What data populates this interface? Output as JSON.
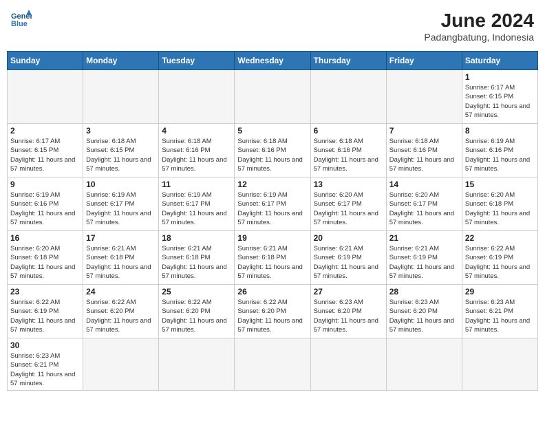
{
  "header": {
    "logo_general": "General",
    "logo_blue": "Blue",
    "month_year": "June 2024",
    "location": "Padangbatung, Indonesia"
  },
  "days_of_week": [
    "Sunday",
    "Monday",
    "Tuesday",
    "Wednesday",
    "Thursday",
    "Friday",
    "Saturday"
  ],
  "weeks": [
    [
      {
        "day": "",
        "empty": true
      },
      {
        "day": "",
        "empty": true
      },
      {
        "day": "",
        "empty": true
      },
      {
        "day": "",
        "empty": true
      },
      {
        "day": "",
        "empty": true
      },
      {
        "day": "",
        "empty": true
      },
      {
        "day": "1",
        "sunrise": "6:17 AM",
        "sunset": "6:15 PM",
        "daylight": "11 hours and 57 minutes."
      }
    ],
    [
      {
        "day": "2",
        "sunrise": "6:17 AM",
        "sunset": "6:15 PM",
        "daylight": "11 hours and 57 minutes."
      },
      {
        "day": "3",
        "sunrise": "6:18 AM",
        "sunset": "6:15 PM",
        "daylight": "11 hours and 57 minutes."
      },
      {
        "day": "4",
        "sunrise": "6:18 AM",
        "sunset": "6:16 PM",
        "daylight": "11 hours and 57 minutes."
      },
      {
        "day": "5",
        "sunrise": "6:18 AM",
        "sunset": "6:16 PM",
        "daylight": "11 hours and 57 minutes."
      },
      {
        "day": "6",
        "sunrise": "6:18 AM",
        "sunset": "6:16 PM",
        "daylight": "11 hours and 57 minutes."
      },
      {
        "day": "7",
        "sunrise": "6:18 AM",
        "sunset": "6:16 PM",
        "daylight": "11 hours and 57 minutes."
      },
      {
        "day": "8",
        "sunrise": "6:19 AM",
        "sunset": "6:16 PM",
        "daylight": "11 hours and 57 minutes."
      }
    ],
    [
      {
        "day": "9",
        "sunrise": "6:19 AM",
        "sunset": "6:16 PM",
        "daylight": "11 hours and 57 minutes."
      },
      {
        "day": "10",
        "sunrise": "6:19 AM",
        "sunset": "6:17 PM",
        "daylight": "11 hours and 57 minutes."
      },
      {
        "day": "11",
        "sunrise": "6:19 AM",
        "sunset": "6:17 PM",
        "daylight": "11 hours and 57 minutes."
      },
      {
        "day": "12",
        "sunrise": "6:19 AM",
        "sunset": "6:17 PM",
        "daylight": "11 hours and 57 minutes."
      },
      {
        "day": "13",
        "sunrise": "6:20 AM",
        "sunset": "6:17 PM",
        "daylight": "11 hours and 57 minutes."
      },
      {
        "day": "14",
        "sunrise": "6:20 AM",
        "sunset": "6:17 PM",
        "daylight": "11 hours and 57 minutes."
      },
      {
        "day": "15",
        "sunrise": "6:20 AM",
        "sunset": "6:18 PM",
        "daylight": "11 hours and 57 minutes."
      }
    ],
    [
      {
        "day": "16",
        "sunrise": "6:20 AM",
        "sunset": "6:18 PM",
        "daylight": "11 hours and 57 minutes."
      },
      {
        "day": "17",
        "sunrise": "6:21 AM",
        "sunset": "6:18 PM",
        "daylight": "11 hours and 57 minutes."
      },
      {
        "day": "18",
        "sunrise": "6:21 AM",
        "sunset": "6:18 PM",
        "daylight": "11 hours and 57 minutes."
      },
      {
        "day": "19",
        "sunrise": "6:21 AM",
        "sunset": "6:18 PM",
        "daylight": "11 hours and 57 minutes."
      },
      {
        "day": "20",
        "sunrise": "6:21 AM",
        "sunset": "6:19 PM",
        "daylight": "11 hours and 57 minutes."
      },
      {
        "day": "21",
        "sunrise": "6:21 AM",
        "sunset": "6:19 PM",
        "daylight": "11 hours and 57 minutes."
      },
      {
        "day": "22",
        "sunrise": "6:22 AM",
        "sunset": "6:19 PM",
        "daylight": "11 hours and 57 minutes."
      }
    ],
    [
      {
        "day": "23",
        "sunrise": "6:22 AM",
        "sunset": "6:19 PM",
        "daylight": "11 hours and 57 minutes."
      },
      {
        "day": "24",
        "sunrise": "6:22 AM",
        "sunset": "6:20 PM",
        "daylight": "11 hours and 57 minutes."
      },
      {
        "day": "25",
        "sunrise": "6:22 AM",
        "sunset": "6:20 PM",
        "daylight": "11 hours and 57 minutes."
      },
      {
        "day": "26",
        "sunrise": "6:22 AM",
        "sunset": "6:20 PM",
        "daylight": "11 hours and 57 minutes."
      },
      {
        "day": "27",
        "sunrise": "6:23 AM",
        "sunset": "6:20 PM",
        "daylight": "11 hours and 57 minutes."
      },
      {
        "day": "28",
        "sunrise": "6:23 AM",
        "sunset": "6:20 PM",
        "daylight": "11 hours and 57 minutes."
      },
      {
        "day": "29",
        "sunrise": "6:23 AM",
        "sunset": "6:21 PM",
        "daylight": "11 hours and 57 minutes."
      }
    ],
    [
      {
        "day": "30",
        "sunrise": "6:23 AM",
        "sunset": "6:21 PM",
        "daylight": "11 hours and 57 minutes."
      },
      {
        "day": "",
        "empty": true
      },
      {
        "day": "",
        "empty": true
      },
      {
        "day": "",
        "empty": true
      },
      {
        "day": "",
        "empty": true
      },
      {
        "day": "",
        "empty": true
      },
      {
        "day": "",
        "empty": true
      }
    ]
  ]
}
